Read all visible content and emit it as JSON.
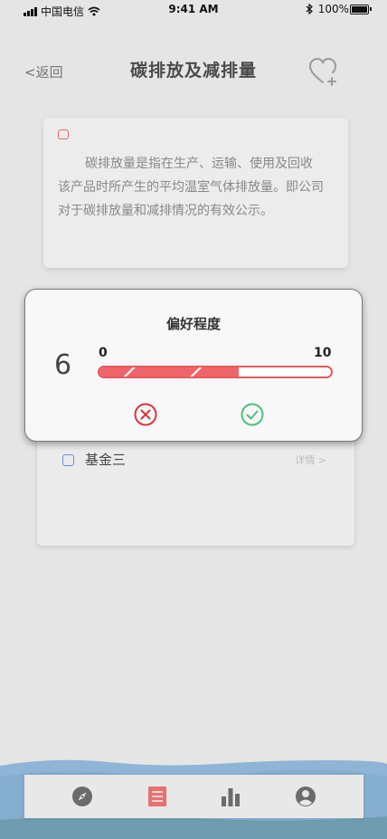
{
  "status_bar": {
    "carrier": "中国电信",
    "time": "9:41 AM",
    "battery_pct": "100%"
  },
  "nav": {
    "back_label": "<返回",
    "title": "碳排放及减排量",
    "fav_icon": "heart-plus-icon"
  },
  "info_card": {
    "text": "碳排放量是指在生产、运输、使用及回收 该产品时所产生的平均温室气体排放量。即公司对于碳排放量和减排情况的有效公示。"
  },
  "fund_card": {
    "label": "基金三",
    "detail_link": "详情 >"
  },
  "dialog": {
    "title": "偏好程度",
    "value": "6",
    "scale_min": "0",
    "scale_max": "10",
    "level_fraction": 0.6,
    "cancel_icon": "close-circle-icon",
    "confirm_icon": "check-circle-icon"
  },
  "tabbar": {
    "tabs": [
      {
        "name": "discover",
        "icon": "compass-icon",
        "active": false
      },
      {
        "name": "list",
        "icon": "list-icon",
        "active": true
      },
      {
        "name": "stats",
        "icon": "bar-chart-icon",
        "active": false
      },
      {
        "name": "profile",
        "icon": "user-icon",
        "active": false
      }
    ]
  },
  "colors": {
    "accent_red": "#f0656a",
    "cancel_red": "#d9363b",
    "confirm_green": "#4cc07a",
    "checkbox_blue": "#6a8fd6",
    "tab_inactive": "#6b6b6b",
    "tab_active": "#e8716f"
  }
}
